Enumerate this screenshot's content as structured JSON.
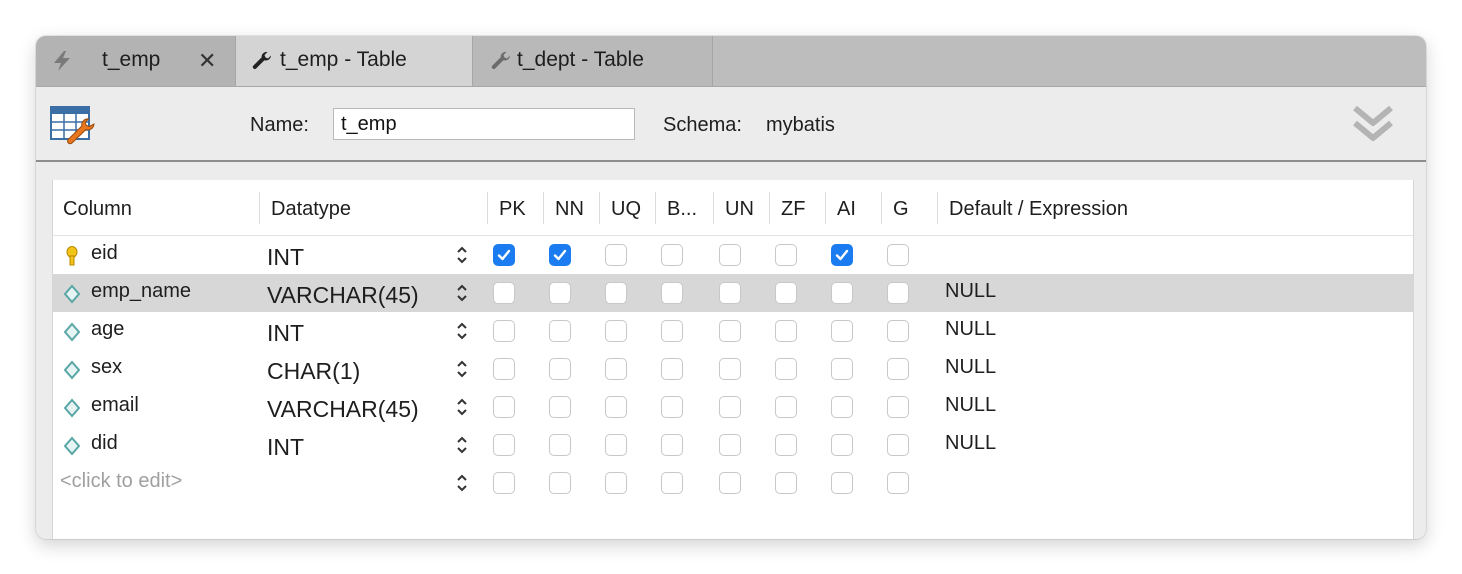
{
  "tabs": [
    {
      "label": "t_emp",
      "icon": "lightning-icon",
      "closable": true
    },
    {
      "label": "t_emp - Table",
      "icon": "wrench-icon",
      "active": true
    },
    {
      "label": "t_dept - Table",
      "icon": "wrench-icon"
    }
  ],
  "header": {
    "name_label": "Name:",
    "name_value": "t_emp",
    "schema_label": "Schema:",
    "schema_value": "mybatis"
  },
  "grid": {
    "headers": [
      "Column",
      "Datatype",
      "PK",
      "NN",
      "UQ",
      "B...",
      "UN",
      "ZF",
      "AI",
      "G",
      "Default / Expression"
    ],
    "rows": [
      {
        "column": "eid",
        "datatype": "INT",
        "flags": [
          true,
          true,
          false,
          false,
          false,
          false,
          true,
          false
        ],
        "default": "",
        "icon": "primary-key-icon"
      },
      {
        "column": "emp_name",
        "datatype": "VARCHAR(45)",
        "flags": [
          false,
          false,
          false,
          false,
          false,
          false,
          false,
          false
        ],
        "default": "NULL",
        "icon": "column-diamond-icon",
        "selected": true
      },
      {
        "column": "age",
        "datatype": "INT",
        "flags": [
          false,
          false,
          false,
          false,
          false,
          false,
          false,
          false
        ],
        "default": "NULL",
        "icon": "column-diamond-icon"
      },
      {
        "column": "sex",
        "datatype": "CHAR(1)",
        "flags": [
          false,
          false,
          false,
          false,
          false,
          false,
          false,
          false
        ],
        "default": "NULL",
        "icon": "column-diamond-icon"
      },
      {
        "column": "email",
        "datatype": "VARCHAR(45)",
        "flags": [
          false,
          false,
          false,
          false,
          false,
          false,
          false,
          false
        ],
        "default": "NULL",
        "icon": "column-diamond-icon"
      },
      {
        "column": "did",
        "datatype": "INT",
        "flags": [
          false,
          false,
          false,
          false,
          false,
          false,
          false,
          false
        ],
        "default": "NULL",
        "icon": "column-diamond-icon"
      }
    ],
    "placeholder": "<click to edit>"
  },
  "colors": {
    "checkbox_checked": "#1a7cf0",
    "selected_row": "#d7d7d7",
    "key_icon": "#f2c318",
    "diamond_icon": "#5aa6a6"
  }
}
